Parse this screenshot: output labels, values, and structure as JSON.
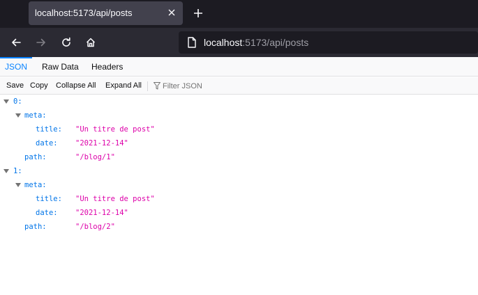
{
  "browser": {
    "tab_title": "localhost:5173/api/posts",
    "url_host": "localhost",
    "url_rest": ":5173/api/posts"
  },
  "viewer": {
    "tabs": [
      "JSON",
      "Raw Data",
      "Headers"
    ],
    "active_tab": "JSON",
    "toolbar": {
      "save": "Save",
      "copy": "Copy",
      "collapse_all": "Collapse All",
      "expand_all": "Expand All",
      "filter_placeholder": "Filter JSON"
    }
  },
  "json": [
    {
      "index": "0:",
      "meta_key": "meta:",
      "title_key": "title:",
      "title": "\"Un titre de post\"",
      "date_key": "date:",
      "date": "\"2021-12-14\"",
      "path_key": "path:",
      "path": "\"/blog/1\""
    },
    {
      "index": "1:",
      "meta_key": "meta:",
      "title_key": "title:",
      "title": "\"Un titre de post\"",
      "date_key": "date:",
      "date": "\"2021-12-14\"",
      "path_key": "path:",
      "path": "\"/blog/2\""
    }
  ],
  "colors": {
    "json_key": "#0074e8",
    "json_string": "#dd00a9",
    "active_tab": "#0a84ff"
  }
}
